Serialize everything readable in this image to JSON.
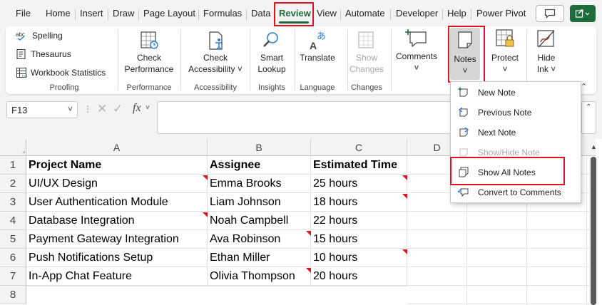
{
  "menu_tabs": [
    "File",
    "Home",
    "Insert",
    "Draw",
    "Page Layout",
    "Formulas",
    "Data",
    "Review",
    "View",
    "Automate",
    "Developer",
    "Help",
    "Power Pivot"
  ],
  "active_tab": "Review",
  "ribbon": {
    "proofing": {
      "items": [
        "Spelling",
        "Thesaurus",
        "Workbook Statistics"
      ],
      "label": "Proofing"
    },
    "performance": {
      "button": [
        "Check",
        "Performance"
      ],
      "label": "Performance"
    },
    "accessibility": {
      "button": [
        "Check",
        "Accessibility ˅"
      ],
      "label": "Accessibility"
    },
    "insights": {
      "button": [
        "Smart",
        "Lookup"
      ],
      "label": "Insights"
    },
    "language": {
      "button": "Translate",
      "label": "Language"
    },
    "changes": {
      "button": [
        "Show",
        "Changes"
      ],
      "label": "Changes"
    },
    "comments": {
      "button": "Comments"
    },
    "notes": {
      "button": "Notes"
    },
    "protect": {
      "button": "Protect"
    },
    "ink": {
      "button": [
        "Hide",
        "Ink ˅"
      ]
    }
  },
  "formula_bar": {
    "name_box": "F13",
    "fx": "fx",
    "value": ""
  },
  "columns": [
    "A",
    "B",
    "C",
    "D"
  ],
  "rows": [
    "1",
    "2",
    "3",
    "4",
    "5",
    "6",
    "7",
    "8"
  ],
  "table": {
    "headers": [
      "Project Name",
      "Assignee",
      "Estimated Time"
    ],
    "rows": [
      [
        "UI/UX Design",
        "Emma Brooks",
        "25 hours"
      ],
      [
        "User Authentication Module",
        "Liam Johnson",
        "18 hours"
      ],
      [
        "Database Integration",
        "Noah Campbell",
        "22 hours"
      ],
      [
        "Payment Gateway Integration",
        "Ava Robinson",
        "15 hours"
      ],
      [
        "Push Notifications Setup",
        "Ethan Miller",
        "10 hours"
      ],
      [
        "In-App Chat Feature",
        "Olivia Thompson",
        "20 hours"
      ]
    ]
  },
  "notes_menu": {
    "items": [
      {
        "label": "New Note",
        "enabled": true
      },
      {
        "label": "Previous Note",
        "enabled": true
      },
      {
        "label": "Next Note",
        "enabled": true
      },
      {
        "label": "Show/Hide Note",
        "enabled": false
      },
      {
        "label": "Show All Notes",
        "enabled": true
      },
      {
        "label": "Convert to Comments",
        "enabled": true
      }
    ]
  },
  "colors": {
    "accent": "#1e6b3c",
    "highlight": "#e0141e",
    "note_indicator": "#e0141e"
  }
}
